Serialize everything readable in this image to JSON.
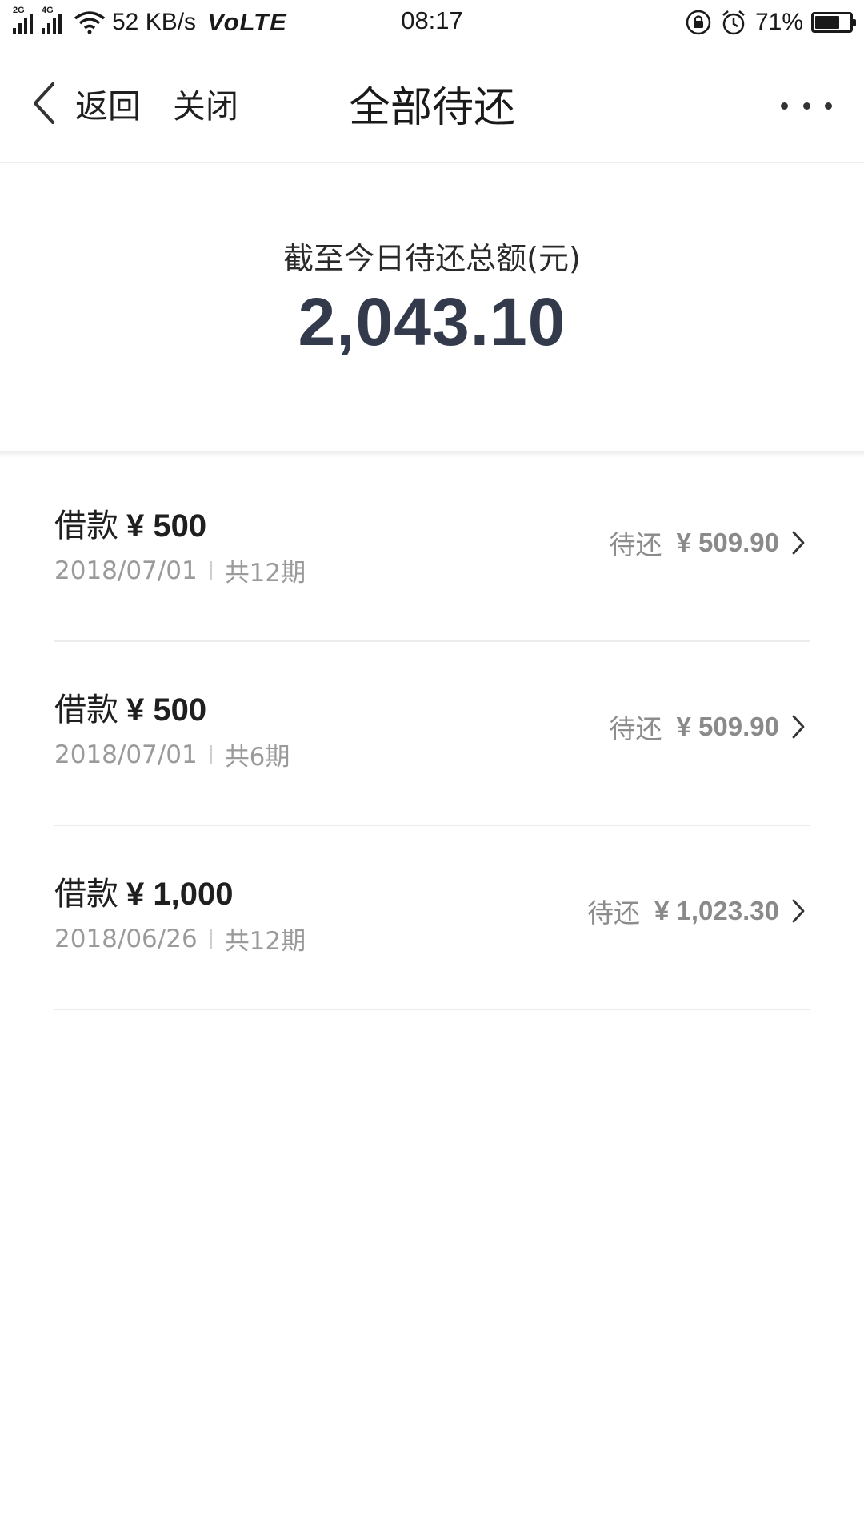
{
  "status_bar": {
    "signal1_tag": "2G",
    "signal2_tag": "4G",
    "net_speed": "52 KB/s",
    "volte": "VoLTE",
    "time": "08:17",
    "battery_percent": "71%",
    "battery_level": 0.71,
    "icons": [
      "signal-icon",
      "wifi-icon",
      "lock-rotation-icon",
      "alarm-icon",
      "battery-icon"
    ]
  },
  "nav": {
    "back_label": "返回",
    "close_label": "关闭",
    "title": "全部待还",
    "icons": [
      "back-chevron-icon",
      "more-icon"
    ]
  },
  "summary": {
    "label": "截至今日待还总额(元)",
    "amount": "2,043.10"
  },
  "loans": [
    {
      "title": "借款",
      "amount": "¥ 500",
      "date": "2018/07/01",
      "periods": "共12期",
      "status": "待还",
      "due": "¥ 509.90"
    },
    {
      "title": "借款",
      "amount": "¥ 500",
      "date": "2018/07/01",
      "periods": "共6期",
      "status": "待还",
      "due": "¥ 509.90"
    },
    {
      "title": "借款",
      "amount": "¥ 1,000",
      "date": "2018/06/26",
      "periods": "共12期",
      "status": "待还",
      "due": "¥ 1,023.30"
    }
  ],
  "colors": {
    "amount_text": "#323a4c",
    "secondary_text": "#9a9a9a",
    "divider": "#ececec"
  }
}
